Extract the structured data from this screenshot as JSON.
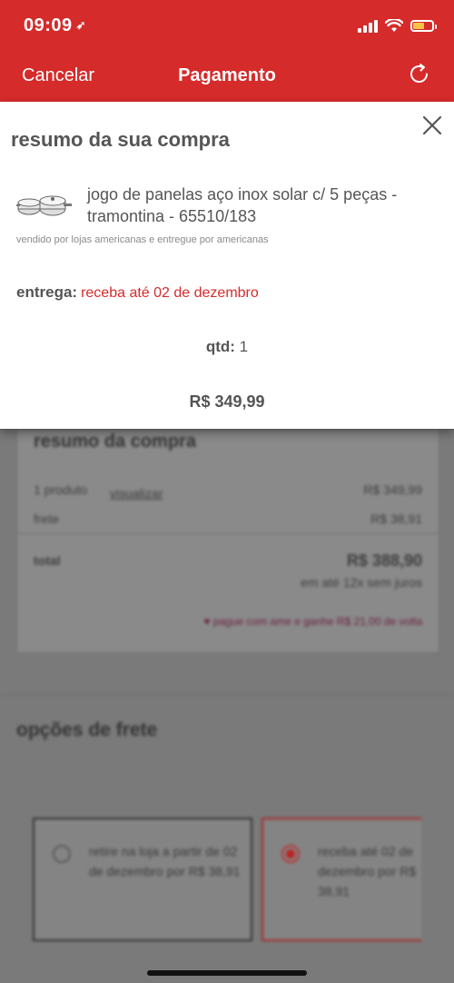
{
  "status_bar": {
    "time": "09:09",
    "location_glyph": "➶"
  },
  "nav": {
    "cancel_label": "Cancelar",
    "title": "Pagamento"
  },
  "sheet": {
    "title": "resumo da sua compra",
    "product_name": "jogo de panelas aço inox solar c/ 5 peças - tramontina - 65510/183",
    "seller_note": "vendido por lojas americanas e entregue por americanas",
    "delivery_label": "entrega:",
    "delivery_value": "receba até 02 de dezembro",
    "qty_label": "qtd:",
    "qty_value": "1",
    "price": "R$ 349,99"
  },
  "summary_card": {
    "title": "resumo da compra",
    "products_label": "1 produto",
    "view_link": "visualizar",
    "products_value": "R$ 349,99",
    "shipping_label": "frete",
    "shipping_value": "R$ 38,91",
    "total_label": "total",
    "total_value": "R$ 388,90",
    "installments": "em até 12x sem juros",
    "ame_promo": "pague com ame e ganhe R$ 21,00 de volta"
  },
  "shipping_options": {
    "title": "opções de frete",
    "options": [
      {
        "text": "retire na loja a partir de 02 de dezembro por R$ 38,91",
        "selected": false
      },
      {
        "text": "receba até 02 de dezembro por R$ 38,91",
        "selected": true
      }
    ]
  },
  "colors": {
    "brand_red": "#d52b2b",
    "battery_yellow": "#f6c445"
  }
}
